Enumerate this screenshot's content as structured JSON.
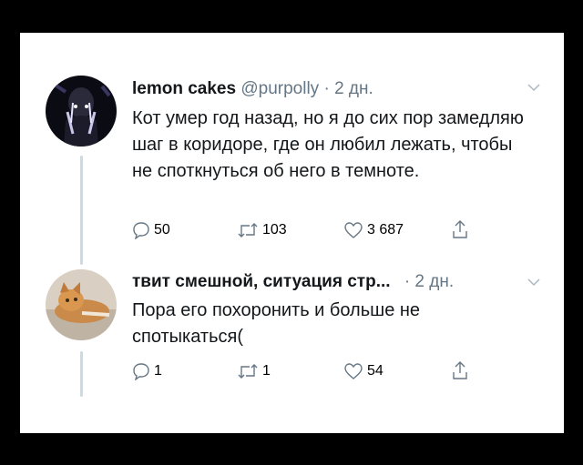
{
  "tweets": [
    {
      "display_name": "lemon cakes",
      "handle": "@purpolly",
      "time": "· 2 дн.",
      "text": "Кот умер год назад, но я до сих пор замедляю шаг в коридоре, где он любил лежать, чтобы не споткнуться об него в темноте.",
      "replies": "50",
      "retweets": "103",
      "likes": "3 687"
    },
    {
      "display_name": "твит смешной, ситуация стр...",
      "time": "· 2 дн.",
      "text": "Пора его похоронить и больше не спотыкаться(",
      "replies": "1",
      "retweets": "1",
      "likes": "54"
    }
  ],
  "icons": {
    "reply": "speech-bubble-icon",
    "retweet": "retweet-arrows-icon",
    "like": "heart-icon",
    "share": "share-upload-icon",
    "more": "chevron-down-icon"
  },
  "colors": {
    "background": "#000000",
    "card": "#ffffff",
    "text": "#14171a",
    "muted": "#657786",
    "thread_line": "#cfd9de"
  }
}
